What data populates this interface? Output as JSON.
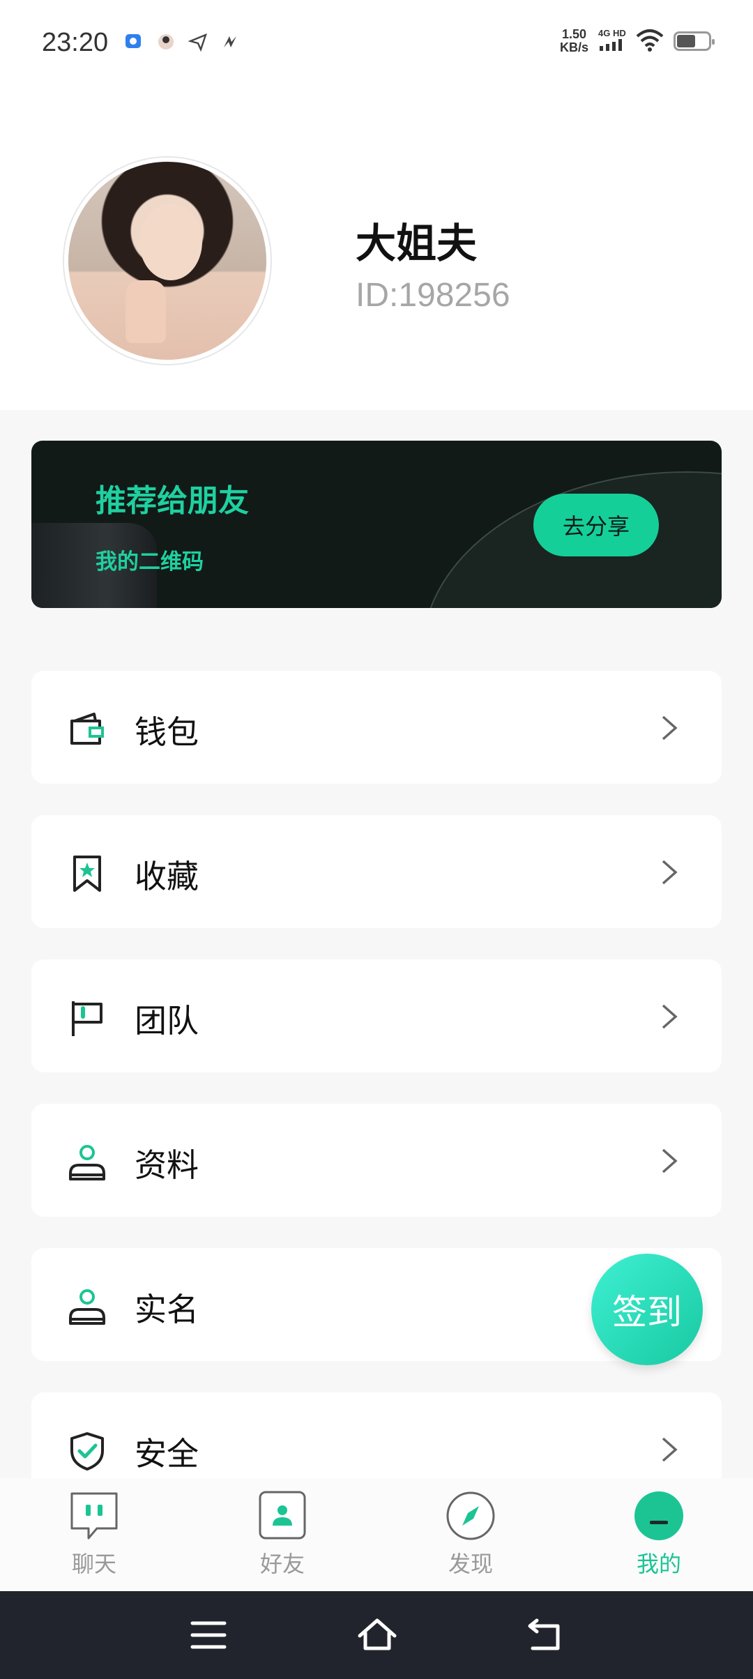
{
  "status_bar": {
    "time": "23:20",
    "speed_value": "1.50",
    "speed_unit": "KB/s",
    "network_top": "4G HD",
    "icons": [
      "chat-app-icon",
      "avatar-notification-icon",
      "send-icon",
      "bolt-app-icon",
      "signal-icon",
      "wifi-icon",
      "battery-icon"
    ]
  },
  "profile": {
    "name": "大姐夫",
    "id_text": "ID:198256"
  },
  "share_banner": {
    "title": "推荐给朋友",
    "subtitle": "我的二维码",
    "button_label": "去分享"
  },
  "menu": {
    "items": [
      {
        "label": "钱包",
        "icon": "wallet-icon"
      },
      {
        "label": "收藏",
        "icon": "bookmark-star-icon"
      },
      {
        "label": "团队",
        "icon": "flag-icon"
      },
      {
        "label": "资料",
        "icon": "person-icon"
      },
      {
        "label": "实名",
        "icon": "person-verify-icon"
      },
      {
        "label": "安全",
        "icon": "shield-check-icon"
      }
    ]
  },
  "signin_button": {
    "label": "签到"
  },
  "bottom_nav": {
    "items": [
      {
        "label": "聊天",
        "icon": "chat-bubble-icon",
        "active": false
      },
      {
        "label": "好友",
        "icon": "contacts-icon",
        "active": false
      },
      {
        "label": "发现",
        "icon": "compass-icon",
        "active": false
      },
      {
        "label": "我的",
        "icon": "profile-face-icon",
        "active": true
      }
    ]
  },
  "colors": {
    "accent": "#1cc494",
    "banner_bg": "#111a17",
    "system_nav_bg": "#21242c"
  }
}
